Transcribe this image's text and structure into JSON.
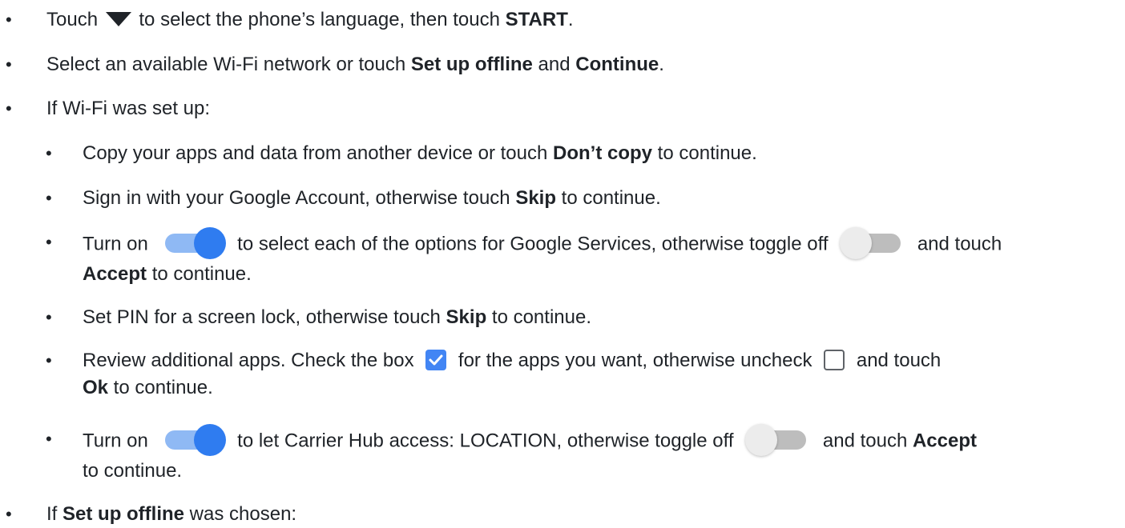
{
  "bullet": "•",
  "icons": {
    "triangle": "dropdown-triangle-icon",
    "toggle_on": "toggle-on-icon",
    "toggle_off": "toggle-off-icon",
    "checkbox_checked": "checkbox-checked-icon",
    "checkbox_unchecked": "checkbox-unchecked-icon"
  },
  "colors": {
    "accent": "#2f7cf0",
    "accent_light": "#8fb9f4",
    "check": "#4285f4",
    "text": "#1f2328"
  },
  "steps": {
    "s1": {
      "a": "Touch ",
      "b": " to select the phone’s language, then touch ",
      "bold": "START",
      "c": "."
    },
    "s2": {
      "a": "Select an available Wi-Fi network or touch ",
      "bold1": "Set up offline",
      "b": " and ",
      "bold2": "Continue",
      "c": "."
    },
    "s3": {
      "a": "If Wi-Fi was set up:"
    },
    "s4": {
      "a": "Copy your apps and data from another device or touch ",
      "bold": "Don’t copy",
      "b": " to continue."
    },
    "s5": {
      "a": "Sign in with your Google Account, otherwise touch ",
      "bold": "Skip",
      "b": " to continue."
    },
    "s6": {
      "a": "Turn on ",
      "b": " to select each of the options for Google Services, otherwise toggle off ",
      "c": " and touch",
      "bold": "Accept",
      "d": " to continue."
    },
    "s7": {
      "a": "Set PIN for a screen lock, otherwise touch ",
      "bold": "Skip",
      "b": " to continue."
    },
    "s8": {
      "a": "Review additional apps. Check the box ",
      "b": " for the apps you want, otherwise uncheck ",
      "c": " and touch",
      "bold": "Ok",
      "d": " to continue."
    },
    "s9": {
      "a": "Turn on ",
      "b": " to let Carrier Hub access: LOCATION, otherwise toggle off ",
      "c": " and touch ",
      "bold": "Accept",
      "d": "to continue."
    },
    "s10": {
      "a": "If ",
      "bold": "Set up offline",
      "b": " was chosen:"
    }
  }
}
